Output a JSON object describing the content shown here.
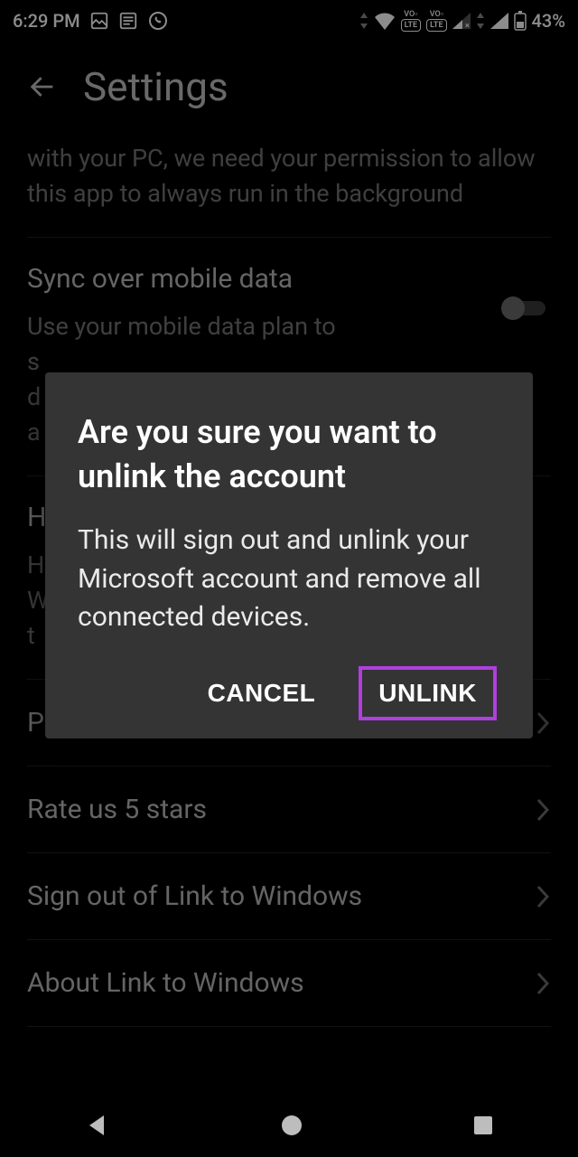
{
  "status": {
    "time": "6:29 PM",
    "battery": "43%"
  },
  "header": {
    "title": "Settings"
  },
  "bg": {
    "perm_desc": "with your PC, we need your permission to allow this app to always run in the background",
    "sync_title": "Sync over mobile data",
    "sync_desc_1": "Use your mobile data plan to",
    "sync_desc_2": "s",
    "sync_desc_3": "d",
    "sync_desc_4": "a",
    "help_title": "H",
    "help_sub_1": "H",
    "help_sub_2": "W",
    "help_sub_3": "t",
    "feedback": "Provide feedback",
    "rate": "Rate us 5 stars",
    "signout": "Sign out of Link to Windows",
    "about": "About Link to Windows"
  },
  "dialog": {
    "title": "Are you sure you want to unlink the account",
    "body": "This will sign out and unlink your Microsoft account and remove all connected devices.",
    "cancel": "CANCEL",
    "unlink": "UNLINK"
  }
}
